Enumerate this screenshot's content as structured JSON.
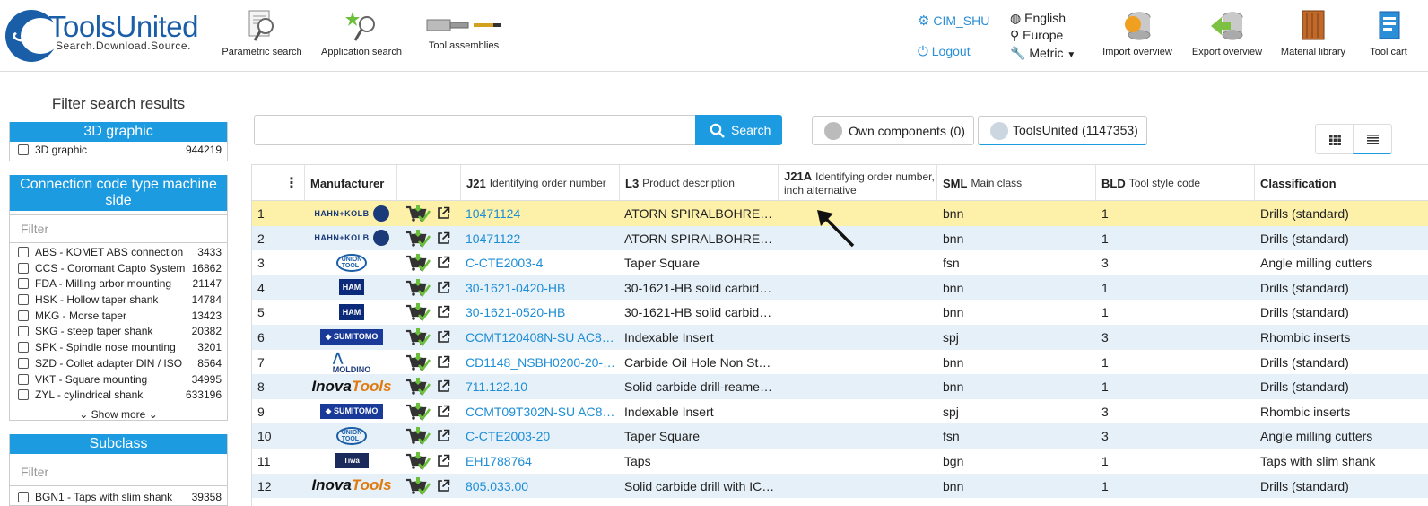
{
  "header": {
    "logo_title": "ToolsUnited",
    "logo_subtitle": "Search.Download.Source.",
    "tools": [
      {
        "label": "Parametric search",
        "icon": "parametric-search-icon"
      },
      {
        "label": "Application search",
        "icon": "application-search-icon"
      },
      {
        "label": "Tool assemblies",
        "icon": "tool-assemblies-icon"
      }
    ],
    "user": {
      "name": "CIM_SHU",
      "logout": "Logout"
    },
    "locale": {
      "language": "English",
      "region": "Europe",
      "units": "Metric"
    },
    "actions": [
      {
        "label": "Import overview",
        "icon": "import-icon"
      },
      {
        "label": "Export overview",
        "icon": "export-icon"
      },
      {
        "label": "Material library",
        "icon": "material-library-icon"
      },
      {
        "label": "Tool cart",
        "icon": "tool-cart-icon"
      }
    ]
  },
  "sidebar": {
    "title": "Filter search results",
    "facets": [
      {
        "title": "3D graphic",
        "items": [
          {
            "name": "3D graphic",
            "count": "944219"
          }
        ]
      },
      {
        "title": "Connection code type machine side",
        "filter_placeholder": "Filter",
        "items": [
          {
            "name": "ABS - KOMET ABS connection",
            "count": "3433"
          },
          {
            "name": "CCS - Coromant Capto System",
            "count": "16862"
          },
          {
            "name": "FDA - Milling arbor mounting",
            "count": "21147"
          },
          {
            "name": "HSK - Hollow taper shank",
            "count": "14784"
          },
          {
            "name": "MKG - Morse taper",
            "count": "13423"
          },
          {
            "name": "SKG - steep taper shank",
            "count": "20382"
          },
          {
            "name": "SPK - Spindle nose mounting",
            "count": "3201"
          },
          {
            "name": "SZD - Collet adapter DIN / ISO",
            "count": "8564"
          },
          {
            "name": "VKT - Square mounting",
            "count": "34995"
          },
          {
            "name": "ZYL - cylindrical shank",
            "count": "633196"
          }
        ],
        "show_more": "Show more"
      },
      {
        "title": "Subclass",
        "filter_placeholder": "Filter",
        "items": [
          {
            "name": "BGN1 - Taps with slim shank",
            "count": "39358"
          }
        ]
      }
    ]
  },
  "search": {
    "value": "",
    "button": "Search",
    "tabs": [
      {
        "label": "Own components (0)"
      },
      {
        "label": "ToolsUnited (1147353)"
      }
    ]
  },
  "table": {
    "columns": [
      {
        "code": "",
        "label": ""
      },
      {
        "code": "",
        "label": "Manufacturer"
      },
      {
        "code": "",
        "label": ""
      },
      {
        "code": "J21",
        "label": "Identifying order number"
      },
      {
        "code": "L3",
        "label": "Product description"
      },
      {
        "code": "J21A",
        "label": "Identifying order number, inch alternative"
      },
      {
        "code": "SML",
        "label": "Main class"
      },
      {
        "code": "BLD",
        "label": "Tool style code"
      },
      {
        "code": "",
        "label": "Classification"
      }
    ],
    "rows": [
      {
        "n": "1",
        "mfr": "HAHN+KOLB",
        "order": "10471124",
        "desc": "ATORN SPIRALBOHRE…",
        "inch": "",
        "sml": "bnn",
        "bld": "1",
        "cls": "Drills (standard)"
      },
      {
        "n": "2",
        "mfr": "HAHN+KOLB",
        "order": "10471122",
        "desc": "ATORN SPIRALBOHRE…",
        "inch": "",
        "sml": "bnn",
        "bld": "1",
        "cls": "Drills (standard)"
      },
      {
        "n": "3",
        "mfr": "UNION TOOL",
        "order": "C-CTE2003-4",
        "desc": "Taper Square",
        "inch": "",
        "sml": "fsn",
        "bld": "3",
        "cls": "Angle milling cutters"
      },
      {
        "n": "4",
        "mfr": "HAM",
        "order": "30-1621-0420-HB",
        "desc": "30-1621-HB solid carbid…",
        "inch": "",
        "sml": "bnn",
        "bld": "1",
        "cls": "Drills (standard)"
      },
      {
        "n": "5",
        "mfr": "HAM",
        "order": "30-1621-0520-HB",
        "desc": "30-1621-HB solid carbid…",
        "inch": "",
        "sml": "bnn",
        "bld": "1",
        "cls": "Drills (standard)"
      },
      {
        "n": "6",
        "mfr": "SUMITOMO",
        "order": "CCMT120408N-SU AC8…",
        "desc": "Indexable Insert",
        "inch": "",
        "sml": "spj",
        "bld": "3",
        "cls": "Rhombic inserts"
      },
      {
        "n": "7",
        "mfr": "MOLDINO",
        "order": "CD1148_NSBH0200-20-…",
        "desc": "Carbide Oil Hole Non St…",
        "inch": "",
        "sml": "bnn",
        "bld": "1",
        "cls": "Drills (standard)"
      },
      {
        "n": "8",
        "mfr": "InovaTools",
        "order": "711.122.10",
        "desc": "Solid carbide drill-reame…",
        "inch": "",
        "sml": "bnn",
        "bld": "1",
        "cls": "Drills (standard)"
      },
      {
        "n": "9",
        "mfr": "SUMITOMO",
        "order": "CCMT09T302N-SU AC8…",
        "desc": "Indexable Insert",
        "inch": "",
        "sml": "spj",
        "bld": "3",
        "cls": "Rhombic inserts"
      },
      {
        "n": "10",
        "mfr": "UNION TOOL",
        "order": "C-CTE2003-20",
        "desc": "Taper Square",
        "inch": "",
        "sml": "fsn",
        "bld": "3",
        "cls": "Angle milling cutters"
      },
      {
        "n": "11",
        "mfr": "Tiwa",
        "order": "EH1788764",
        "desc": "Taps",
        "inch": "",
        "sml": "bgn",
        "bld": "1",
        "cls": "Taps with slim shank"
      },
      {
        "n": "12",
        "mfr": "InovaTools",
        "order": "805.033.00",
        "desc": "Solid carbide drill with IC…",
        "inch": "",
        "sml": "bnn",
        "bld": "1",
        "cls": "Drills (standard)"
      }
    ]
  },
  "colors": {
    "accent": "#1d9be1",
    "link": "#1d8ed6",
    "row_alt": "#e6f0f8",
    "row_selected": "#fdf0a8"
  }
}
